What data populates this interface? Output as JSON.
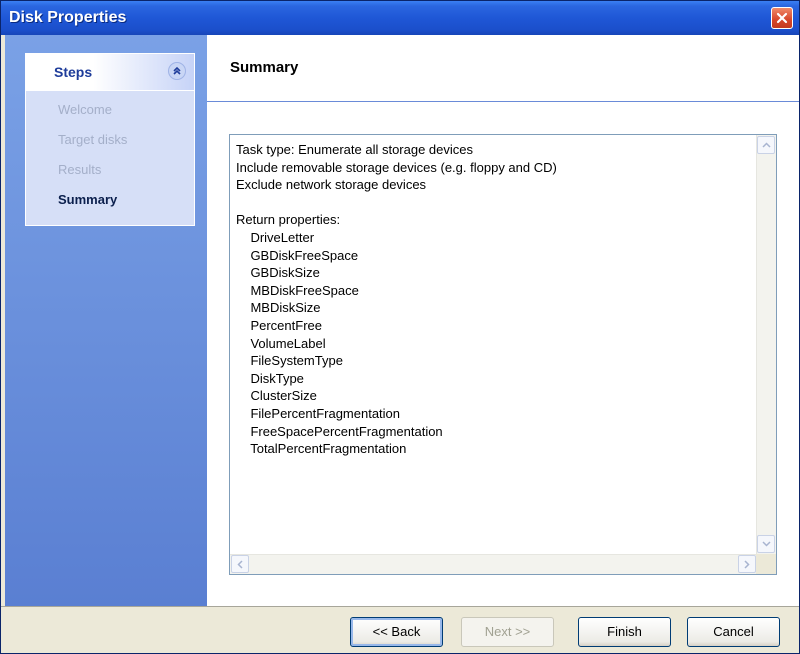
{
  "window": {
    "title": "Disk Properties"
  },
  "steps": {
    "header": "Steps",
    "collapse_glyph": "»",
    "items": [
      {
        "label": "Welcome",
        "active": false
      },
      {
        "label": "Target disks",
        "active": false
      },
      {
        "label": "Results",
        "active": false
      },
      {
        "label": "Summary",
        "active": true
      }
    ]
  },
  "content": {
    "title": "Summary",
    "summary_lines": [
      "Task type: Enumerate all storage devices",
      "Include removable storage devices (e.g. floppy and CD)",
      "Exclude network storage devices",
      "",
      "Return properties:",
      "    DriveLetter",
      "    GBDiskFreeSpace",
      "    GBDiskSize",
      "    MBDiskFreeSpace",
      "    MBDiskSize",
      "    PercentFree",
      "    VolumeLabel",
      "    FileSystemType",
      "    DiskType",
      "    ClusterSize",
      "    FilePercentFragmentation",
      "    FreeSpacePercentFragmentation",
      "    TotalPercentFragmentation"
    ]
  },
  "buttons": {
    "back": "<< Back",
    "next": "Next >>",
    "finish": "Finish",
    "cancel": "Cancel"
  },
  "icons": {
    "close": "close-icon",
    "collapse": "chevron-double-up-icon",
    "scroll_up": "scroll-up-icon",
    "scroll_down": "scroll-down-icon",
    "scroll_left": "scroll-left-icon",
    "scroll_right": "scroll-right-icon"
  }
}
